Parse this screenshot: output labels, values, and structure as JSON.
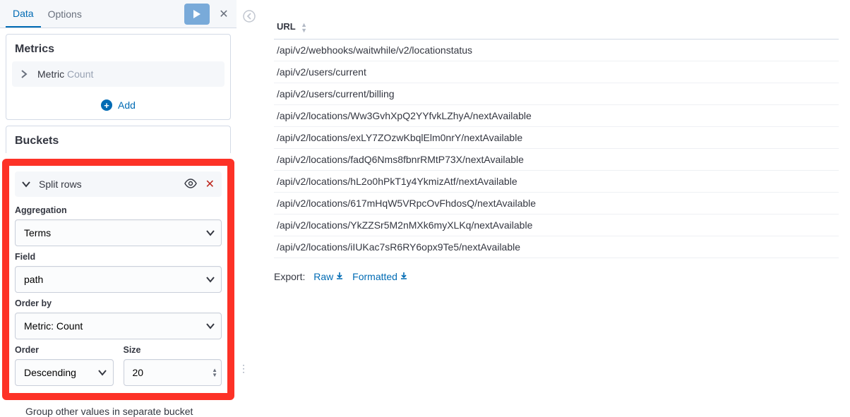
{
  "tabs": {
    "data": "Data",
    "options": "Options"
  },
  "metrics": {
    "title": "Metrics",
    "row_label": "Metric",
    "row_value": "Count",
    "add_label": "Add"
  },
  "buckets": {
    "title": "Buckets",
    "split": {
      "label": "Split rows",
      "aggregation_label": "Aggregation",
      "aggregation_value": "Terms",
      "field_label": "Field",
      "field_value": "path",
      "orderby_label": "Order by",
      "orderby_value": "Metric: Count",
      "order_label": "Order",
      "order_value": "Descending",
      "size_label": "Size",
      "size_value": "20",
      "group_other": "Group other values in separate bucket"
    }
  },
  "table": {
    "header": "URL",
    "rows": [
      "/api/v2/webhooks/waitwhile/v2/locationstatus",
      "/api/v2/users/current",
      "/api/v2/users/current/billing",
      "/api/v2/locations/Ww3GvhXpQ2YYfvkLZhyA/nextAvailable",
      "/api/v2/locations/exLY7ZOzwKbqlElm0nrY/nextAvailable",
      "/api/v2/locations/fadQ6Nms8fbnrRMtP73X/nextAvailable",
      "/api/v2/locations/hL2o0hPkT1y4YkmizAtf/nextAvailable",
      "/api/v2/locations/617mHqW5VRpcOvFhdosQ/nextAvailable",
      "/api/v2/locations/YkZZSr5M2nMXk6myXLKq/nextAvailable",
      "/api/v2/locations/iIUKac7sR6RY6opx9Te5/nextAvailable"
    ]
  },
  "export": {
    "label": "Export:",
    "raw": "Raw",
    "formatted": "Formatted"
  }
}
